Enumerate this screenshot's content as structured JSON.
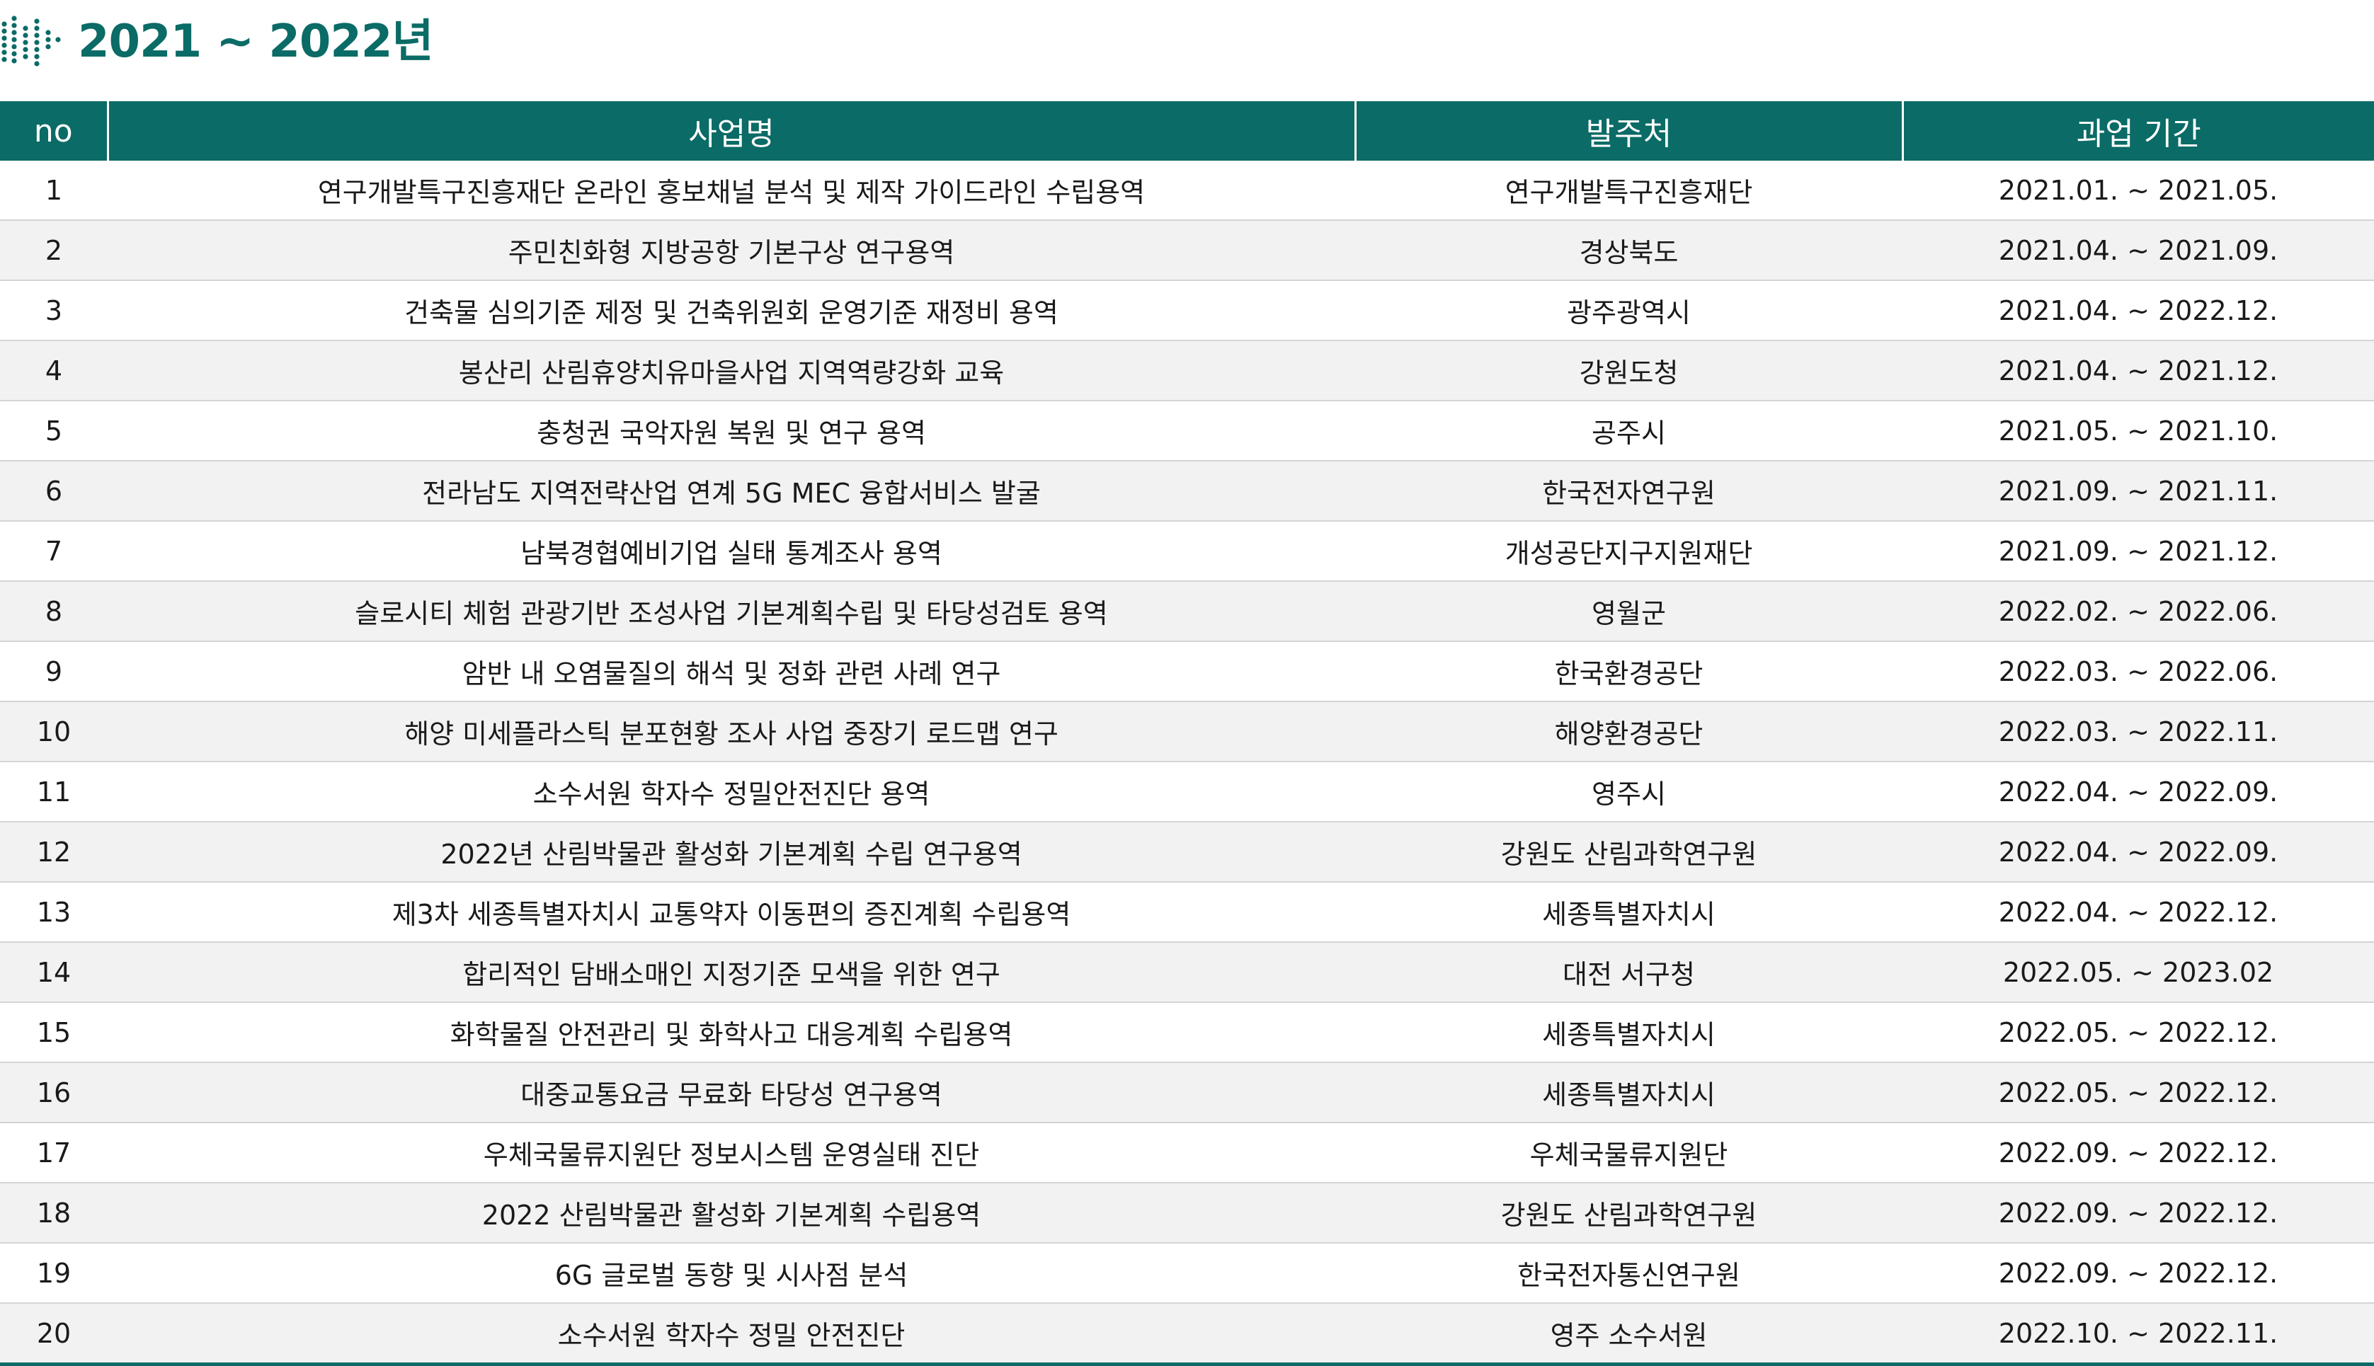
{
  "header": {
    "title": "2021 ~ 2022년",
    "icon": "dotted-arrow-icon",
    "accent_color": "#0b6b66"
  },
  "table": {
    "columns": [
      "no",
      "사업명",
      "발주처",
      "과업 기간"
    ],
    "rows": [
      {
        "no": "1",
        "name": "연구개발특구진흥재단 온라인 홍보채널 분석 및 제작 가이드라인 수립용역",
        "client": "연구개발특구진흥재단",
        "period": "2021.01. ~ 2021.05."
      },
      {
        "no": "2",
        "name": "주민친화형 지방공항 기본구상 연구용역",
        "client": "경상북도",
        "period": "2021.04. ~ 2021.09."
      },
      {
        "no": "3",
        "name": "건축물 심의기준 제정 및 건축위원회 운영기준 재정비 용역",
        "client": "광주광역시",
        "period": "2021.04. ~ 2022.12."
      },
      {
        "no": "4",
        "name": "봉산리 산림휴양치유마을사업 지역역량강화 교육",
        "client": "강원도청",
        "period": "2021.04. ~ 2021.12."
      },
      {
        "no": "5",
        "name": "충청권 국악자원 복원 및 연구 용역",
        "client": "공주시",
        "period": "2021.05. ~ 2021.10."
      },
      {
        "no": "6",
        "name": "전라남도 지역전략산업 연계 5G MEC 융합서비스 발굴",
        "client": "한국전자연구원",
        "period": "2021.09. ~ 2021.11."
      },
      {
        "no": "7",
        "name": "남북경협예비기업 실태 통계조사 용역",
        "client": "개성공단지구지원재단",
        "period": "2021.09. ~ 2021.12."
      },
      {
        "no": "8",
        "name": "슬로시티 체험 관광기반 조성사업 기본계획수립 및 타당성검토 용역",
        "client": "영월군",
        "period": "2022.02. ~ 2022.06."
      },
      {
        "no": "9",
        "name": "암반 내 오염물질의 해석 및 정화 관련 사례 연구",
        "client": "한국환경공단",
        "period": "2022.03. ~ 2022.06."
      },
      {
        "no": "10",
        "name": "해양 미세플라스틱 분포현황 조사 사업 중장기 로드맵 연구",
        "client": "해양환경공단",
        "period": "2022.03. ~ 2022.11."
      },
      {
        "no": "11",
        "name": "소수서원 학자수 정밀안전진단 용역",
        "client": "영주시",
        "period": "2022.04. ~ 2022.09."
      },
      {
        "no": "12",
        "name": "2022년 산림박물관 활성화 기본계획 수립 연구용역",
        "client": "강원도 산림과학연구원",
        "period": "2022.04. ~ 2022.09."
      },
      {
        "no": "13",
        "name": "제3차 세종특별자치시 교통약자 이동편의 증진계획 수립용역",
        "client": "세종특별자치시",
        "period": "2022.04. ~ 2022.12."
      },
      {
        "no": "14",
        "name": "합리적인 담배소매인 지정기준 모색을 위한 연구",
        "client": "대전 서구청",
        "period": "2022.05. ~ 2023.02"
      },
      {
        "no": "15",
        "name": "화학물질 안전관리 및 화학사고 대응계획 수립용역",
        "client": "세종특별자치시",
        "period": "2022.05. ~ 2022.12."
      },
      {
        "no": "16",
        "name": "대중교통요금 무료화 타당성 연구용역",
        "client": "세종특별자치시",
        "period": "2022.05. ~ 2022.12."
      },
      {
        "no": "17",
        "name": "우체국물류지원단 정보시스템 운영실태 진단",
        "client": "우체국물류지원단",
        "period": "2022.09. ~ 2022.12."
      },
      {
        "no": "18",
        "name": "2022 산림박물관 활성화 기본계획 수립용역",
        "client": "강원도 산림과학연구원",
        "period": "2022.09. ~ 2022.12."
      },
      {
        "no": "19",
        "name": "6G 글로벌 동향 및 시사점 분석",
        "client": "한국전자통신연구원",
        "period": "2022.09. ~ 2022.12."
      },
      {
        "no": "20",
        "name": "소수서원 학자수 정밀 안전진단",
        "client": "영주 소수서원",
        "period": "2022.10. ~ 2022.11."
      }
    ]
  }
}
